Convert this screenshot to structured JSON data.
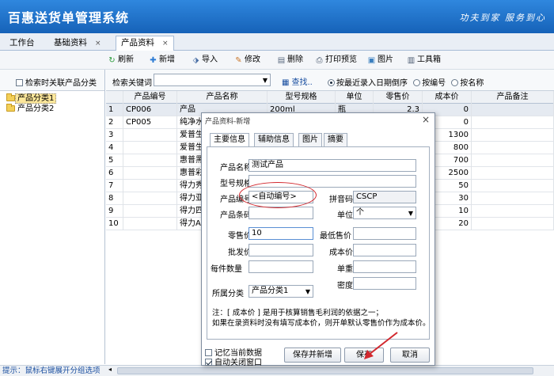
{
  "header": {
    "title": "百惠送货单管理系统",
    "slogan": "功夫到家 服务到心"
  },
  "tabs": [
    {
      "label": "工作台"
    },
    {
      "label": "基础资料",
      "close": "×"
    },
    {
      "label": "产品资料",
      "close": "×"
    }
  ],
  "toolbar": {
    "refresh": "刷新",
    "add": "新增",
    "import": "导入",
    "edit": "修改",
    "delete": "删除",
    "print_preview": "打印预览",
    "image": "图片",
    "toolbox": "工具箱"
  },
  "left_panel": {
    "search_linked_label": "检索时关联产品分类",
    "tree": [
      "产品分类1",
      "产品分类2"
    ]
  },
  "search": {
    "label": "检索关键词",
    "find_label": "查找..",
    "radios": [
      {
        "label": "按最近录入日期倒序",
        "selected": true
      },
      {
        "label": "按编号",
        "selected": false
      },
      {
        "label": "按名称",
        "selected": false
      }
    ]
  },
  "grid": {
    "columns": [
      "产品编号",
      "产品名称",
      "型号规格",
      "单位",
      "零售价",
      "成本价",
      "产品备注"
    ],
    "rows": [
      {
        "n": "1",
        "code": "CP006",
        "name": "产品",
        "spec": "200ml",
        "unit": "瓶",
        "retail": "2.3",
        "cost": "0"
      },
      {
        "n": "2",
        "code": "CP005",
        "name": "纯净水",
        "spec": "",
        "unit": "",
        "retail": "",
        "cost": "0"
      },
      {
        "n": "3",
        "code": "",
        "name": "爱普生",
        "spec": "",
        "unit": "",
        "retail": "",
        "cost": "1300"
      },
      {
        "n": "4",
        "code": "",
        "name": "爱普生",
        "spec": "",
        "unit": "",
        "retail": "",
        "cost": "800"
      },
      {
        "n": "5",
        "code": "",
        "name": "惠普黑",
        "spec": "",
        "unit": "",
        "retail": "",
        "cost": "700"
      },
      {
        "n": "6",
        "code": "",
        "name": "惠普彩",
        "spec": "",
        "unit": "",
        "retail": "",
        "cost": "2500"
      },
      {
        "n": "7",
        "code": "",
        "name": "得力秀",
        "spec": "",
        "unit": "",
        "retail": "",
        "cost": "50"
      },
      {
        "n": "8",
        "code": "",
        "name": "得力亚",
        "spec": "",
        "unit": "",
        "retail": "",
        "cost": "30"
      },
      {
        "n": "9",
        "code": "",
        "name": "得力四",
        "spec": "",
        "unit": "",
        "retail": "",
        "cost": "10"
      },
      {
        "n": "10",
        "code": "",
        "name": "得力A4",
        "spec": "",
        "unit": "",
        "retail": "",
        "cost": "20"
      }
    ]
  },
  "status": {
    "hint": "提示：鼠标右键展开分组选项"
  },
  "dialog": {
    "title": "产品资料-新增",
    "close": "×",
    "tabs": [
      "主要信息",
      "辅助信息",
      "图片",
      "摘要"
    ],
    "fields": {
      "name_label": "产品名称",
      "name_value": "测试产品",
      "spec_label": "型号规格",
      "spec_value": "",
      "code_label": "产品编号",
      "code_value": "<自动编号>",
      "pinyin_label": "拼音码",
      "pinyin_value": "CSCP",
      "barcode_label": "产品条码",
      "barcode_value": "",
      "unit_label": "单位",
      "unit_value": "个",
      "retail_label": "零售价",
      "retail_value": "10",
      "min_price_label": "最低售价",
      "min_price_value": "",
      "wholesale_label": "批发价",
      "wholesale_value": "",
      "cost_label": "成本价",
      "cost_value": "",
      "per_qty_label": "每件数量",
      "per_qty_value": "",
      "weight_label": "单重",
      "weight_value": "",
      "density_label": "密度",
      "density_value": "",
      "category_label": "所属分类",
      "category_value": "产品分类1"
    },
    "note_line1": "注：[ 成本价 ] 是用于核算销售毛利润的依据之一；",
    "note_line2": "如果在录资料时没有填写成本价，则开单默认零售价作为成本价。",
    "remember_label": "记忆当前数据",
    "autoclose_label": "自动关闭窗口",
    "save_new": "保存并新增",
    "save": "保存",
    "cancel": "取消"
  },
  "colors": {
    "header": "#1f6fc8",
    "annotation": "#d2282e",
    "tree_selected": "#fde79a"
  }
}
